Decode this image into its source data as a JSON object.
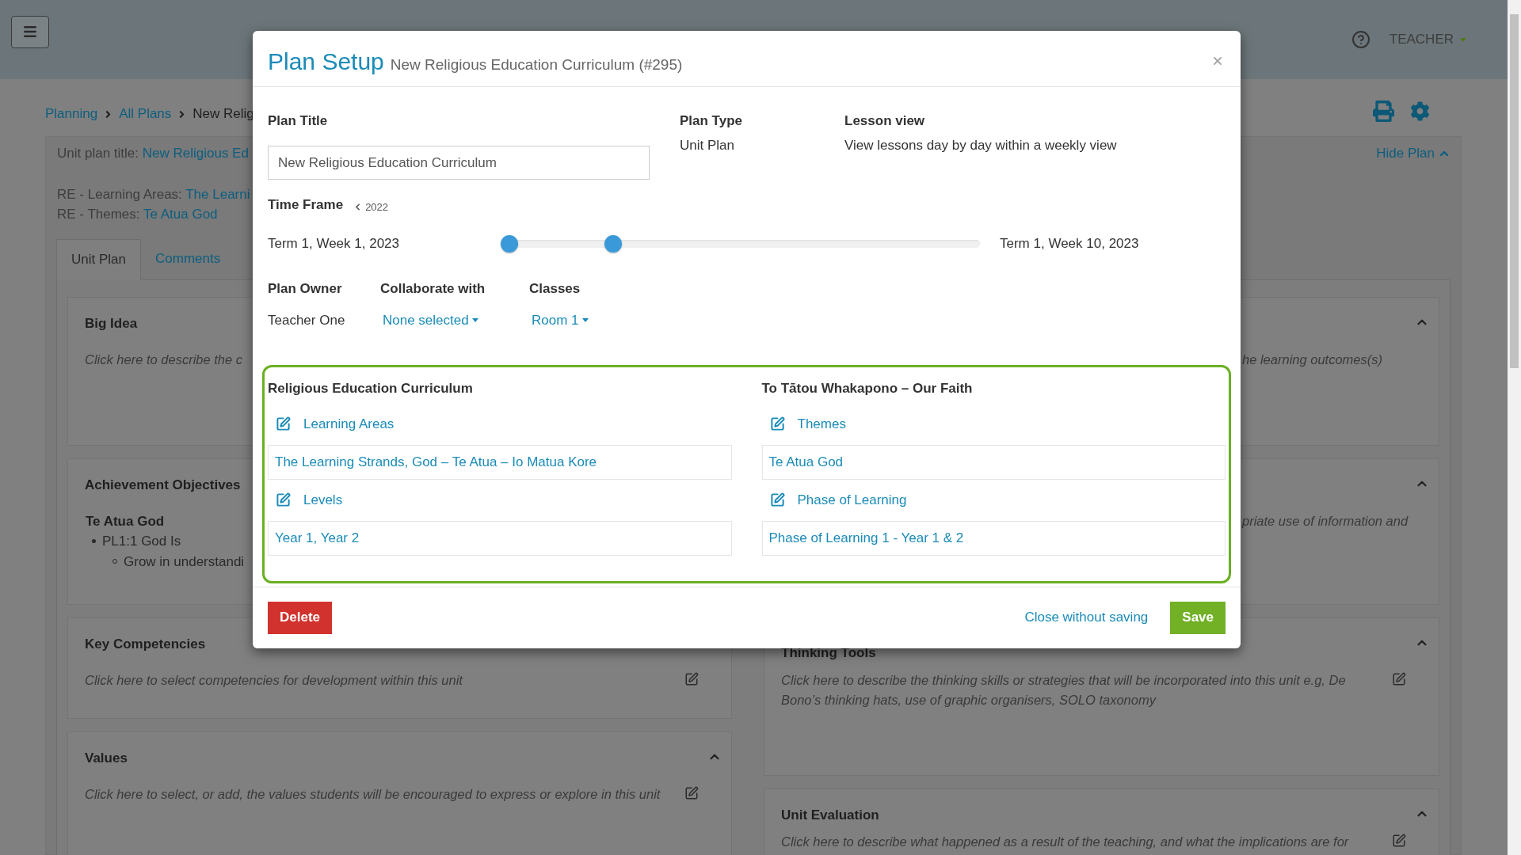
{
  "header": {
    "user_menu": "TEACHER"
  },
  "breadcrumb": [
    {
      "label": "Planning",
      "link": true
    },
    {
      "label": "All Plans",
      "link": true
    },
    {
      "label": "New Relig",
      "link": false
    }
  ],
  "plan_summary": {
    "title_label": "Unit plan title:",
    "title_value": "New Religious Ed",
    "hide_plan": "Hide Plan",
    "fields": [
      {
        "label": "RE - Learning Areas:",
        "value": "The Learni"
      },
      {
        "label": "RE - Themes:",
        "value": "Te Atua God"
      }
    ]
  },
  "tabs": [
    {
      "label": "Unit Plan",
      "selected": true
    },
    {
      "label": "Comments",
      "selected": false
    }
  ],
  "left_cards": [
    {
      "kind": "text",
      "title": "Big Idea",
      "text": "Click here to describe the c"
    },
    {
      "kind": "objectives",
      "title": "Achievement Objectives",
      "heading": "Te Atua God",
      "items": [
        {
          "text": "PL1:1 God Is",
          "children": [
            {
              "text": "Grow in understandi"
            }
          ]
        }
      ]
    },
    {
      "kind": "text",
      "title": "Key Competencies",
      "text": "Click here to select competencies for development within this unit"
    },
    {
      "kind": "text",
      "title": "Values",
      "text": "Click here to select, or add, the values students will be encouraged to express or explore in this unit"
    }
  ],
  "right_cards": [
    {
      "kind": "tail",
      "text": "he learning outcomes(s)"
    },
    {
      "kind": "tail",
      "text": "priate use of information and"
    },
    {
      "kind": "text",
      "title": "Thinking Tools",
      "text": "Click here to describe the thinking skills or strategies that will be incorporated into this unit e.g, De Bono’s thinking hats, use of graphic organisers, SOLO taxonomy"
    },
    {
      "kind": "text",
      "title": "Unit Evaluation",
      "text": "Click here to describe what happened as a result of the teaching, and what the implications are for"
    }
  ],
  "dialog": {
    "title": "Plan Setup",
    "subtitle": "New Religious Education Curriculum (#295)",
    "plan_title": {
      "label": "Plan Title",
      "value": "New Religious Education Curriculum"
    },
    "plan_type": {
      "label": "Plan Type",
      "value": "Unit Plan"
    },
    "lesson_view": {
      "label": "Lesson view",
      "value": "View lessons day by day within a weekly view"
    },
    "time_frame": {
      "label": "Time Frame",
      "previous_year": "2022",
      "start": "Term 1, Week 1, 2023",
      "end": "Term 1, Week 10, 2023",
      "handles": [
        {
          "level": 0
        },
        {
          "level": 0.224
        }
      ]
    },
    "plan_owner": {
      "label": "Plan Owner",
      "value": "Teacher One"
    },
    "collaborate_with": {
      "label": "Collaborate with",
      "value": "None selected"
    },
    "classes": {
      "label": "Classes",
      "value": "Room 1"
    },
    "curricula": [
      {
        "heading": "Religious Education Curriculum",
        "groups": [
          {
            "label": "Learning Areas",
            "value": "The Learning Strands, God – Te Atua – Io Matua Kore"
          },
          {
            "label": "Levels",
            "value": "Year 1, Year 2"
          }
        ]
      },
      {
        "heading": "To Tātou Whakapono – Our Faith",
        "groups": [
          {
            "label": "Themes",
            "value": "Te Atua God"
          },
          {
            "label": "Phase of Learning",
            "value": "Phase of Learning 1 - Year 1 & 2"
          }
        ]
      }
    ],
    "buttons": {
      "delete": "Delete",
      "close": "Close without saving",
      "save": "Save"
    }
  }
}
